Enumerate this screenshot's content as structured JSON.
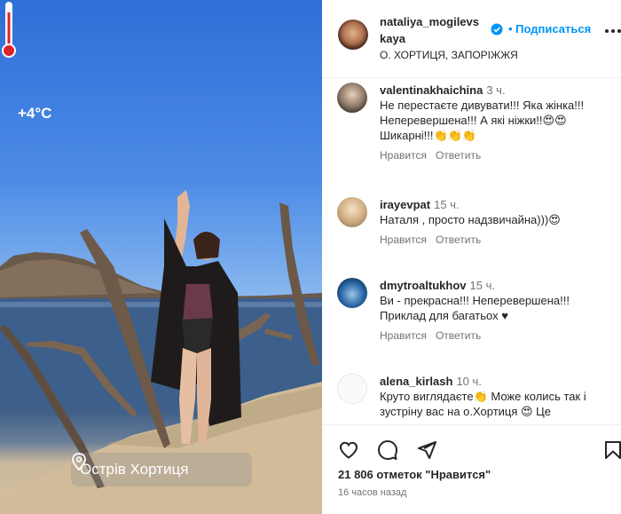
{
  "photo": {
    "temperature": "+4°C",
    "location_tag": "Острів Хортиця"
  },
  "post": {
    "username_line1": "nataliya_mogilevs",
    "username_line2": "kaya",
    "follow_label": "• Подписаться",
    "location": "О. ХОРТИЦЯ, ЗАПОРІЖЖЯ"
  },
  "comments": [
    {
      "username": "valentinakhaichina",
      "time": "3 ч.",
      "text": "Не перестаєте дивувати!!! Яка жінка!!! Неперевершена!!! А які ніжки!!😍😍 Шикарні!!!👏👏👏",
      "like_label": "Нравится",
      "reply_label": "Ответить"
    },
    {
      "username": "irayevpat",
      "time": "15 ч.",
      "text": "Наталя , просто надзвичайна)))😍",
      "like_label": "Нравится",
      "reply_label": "Ответить"
    },
    {
      "username": "dmytroaltukhov",
      "time": "15 ч.",
      "text": "Ви - прекрасна!!! Неперевершена!!! Приклад для багатьох ♥",
      "like_label": "Нравится",
      "reply_label": "Ответить"
    },
    {
      "username": "alena_kirlash",
      "time": "10 ч.",
      "text": "Круто виглядаєте👏 Може колись так і зустріну вас на о.Хортиця 😍 Це",
      "like_label": "",
      "reply_label": ""
    }
  ],
  "footer": {
    "likes": "21 806 отметок \"Нравится\"",
    "posted_ago": "16 часов назад",
    "icons": [
      "heart-icon",
      "comment-icon",
      "share-icon",
      "bookmark-icon"
    ]
  },
  "colors": {
    "accent": "#0095f6",
    "muted": "#737373",
    "text": "#262626"
  }
}
